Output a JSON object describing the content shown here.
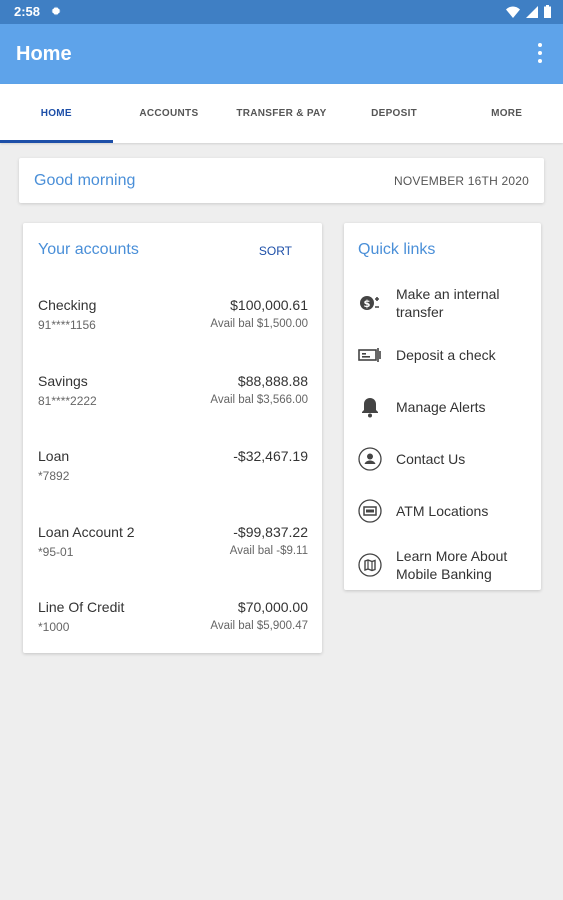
{
  "status_bar": {
    "time": "2:58"
  },
  "app_bar": {
    "title": "Home"
  },
  "tabs": [
    {
      "label": "HOME"
    },
    {
      "label": "ACCOUNTS"
    },
    {
      "label": "TRANSFER & PAY"
    },
    {
      "label": "DEPOSIT"
    },
    {
      "label": "MORE"
    }
  ],
  "greeting": {
    "text": "Good morning",
    "date": "NOVEMBER 16TH 2020"
  },
  "accounts": {
    "title": "Your accounts",
    "sort_label": "SORT",
    "items": [
      {
        "name": "Checking",
        "number": "91****1156",
        "balance": "$100,000.61",
        "available": "Avail bal $1,500.00"
      },
      {
        "name": "Savings",
        "number": "81****2222",
        "balance": "$88,888.88",
        "available": "Avail bal $3,566.00"
      },
      {
        "name": "Loan",
        "number": "*7892",
        "balance": "-$32,467.19",
        "available": ""
      },
      {
        "name": "Loan Account 2",
        "number": "*95-01",
        "balance": "-$99,837.22",
        "available": "Avail bal -$9.11"
      },
      {
        "name": "Line Of Credit",
        "number": "*1000",
        "balance": "$70,000.00",
        "available": "Avail bal $5,900.47"
      }
    ]
  },
  "quick_links": {
    "title": "Quick links",
    "items": [
      {
        "label": "Make an internal transfer",
        "icon": "transfer-icon"
      },
      {
        "label": "Deposit a check",
        "icon": "check-deposit-icon"
      },
      {
        "label": "Manage Alerts",
        "icon": "bell-icon"
      },
      {
        "label": "Contact Us",
        "icon": "person-icon"
      },
      {
        "label": "ATM Locations",
        "icon": "atm-icon"
      },
      {
        "label": "Learn More About Mobile Banking",
        "icon": "map-icon"
      }
    ]
  },
  "colors": {
    "status_bar": "#3f7fc4",
    "app_bar": "#5ea3ea",
    "accent": "#1d4fa8",
    "link_title": "#4a8fd8"
  }
}
